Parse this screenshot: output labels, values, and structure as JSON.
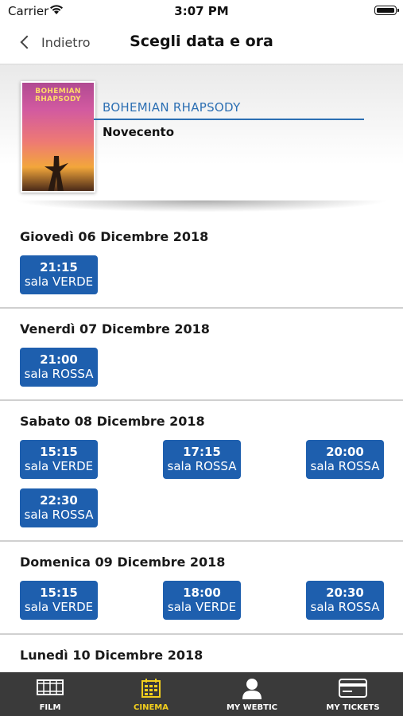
{
  "status": {
    "carrier": "Carrier",
    "time": "3:07 PM"
  },
  "nav": {
    "back_label": "Indietro",
    "title": "Scegli data e ora"
  },
  "movie": {
    "title": "BOHEMIAN RHAPSODY",
    "cinema": "Novecento",
    "poster_text": "BOHEMIAN RHAPSODY"
  },
  "days": [
    {
      "date": "Giovedì 06 Dicembre 2018",
      "shows": [
        {
          "time": "21:15",
          "room": "sala VERDE"
        }
      ]
    },
    {
      "date": "Venerdì 07 Dicembre 2018",
      "shows": [
        {
          "time": "21:00",
          "room": "sala ROSSA"
        }
      ]
    },
    {
      "date": "Sabato 08 Dicembre 2018",
      "shows": [
        {
          "time": "15:15",
          "room": "sala VERDE"
        },
        {
          "time": "17:15",
          "room": "sala ROSSA"
        },
        {
          "time": "20:00",
          "room": "sala ROSSA"
        },
        {
          "time": "22:30",
          "room": "sala ROSSA"
        }
      ]
    },
    {
      "date": "Domenica 09 Dicembre 2018",
      "shows": [
        {
          "time": "15:15",
          "room": "sala VERDE"
        },
        {
          "time": "18:00",
          "room": "sala VERDE"
        },
        {
          "time": "20:30",
          "room": "sala ROSSA"
        }
      ]
    },
    {
      "date": "Lunedì 10 Dicembre 2018",
      "shows": []
    }
  ],
  "tabs": [
    {
      "label": "FILM",
      "icon": "film-icon",
      "active": false
    },
    {
      "label": "CINEMA",
      "icon": "calendar-icon",
      "active": true
    },
    {
      "label": "MY WEBTIC",
      "icon": "user-icon",
      "active": false
    },
    {
      "label": "MY TICKETS",
      "icon": "credit-card-icon",
      "active": false
    }
  ],
  "colors": {
    "accent": "#1e5fae",
    "title_blue": "#2c6fb3",
    "tab_active": "#f2cf1d",
    "tabbar_bg": "#3a3a3a"
  }
}
